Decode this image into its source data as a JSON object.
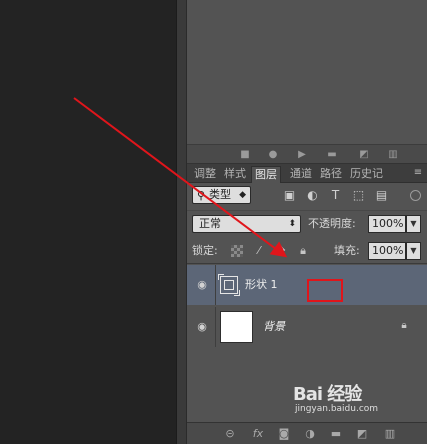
{
  "upper_toolbar": {
    "icons": [
      "stop-icon",
      "record-icon",
      "play-icon",
      "folder-icon",
      "new-action-icon",
      "trash-icon"
    ]
  },
  "tabs": [
    {
      "label": "调整",
      "active": false
    },
    {
      "label": "样式",
      "active": false
    },
    {
      "label": "图层",
      "active": true
    },
    {
      "label": "通道",
      "active": false
    },
    {
      "label": "路径",
      "active": false
    },
    {
      "label": "历史记",
      "active": false
    }
  ],
  "filter": {
    "kind_label": "类型",
    "icons": [
      "pixel-filter-icon",
      "adjustment-filter-icon",
      "type-filter-icon",
      "shape-filter-icon",
      "smart-object-filter-icon"
    ]
  },
  "blend": {
    "mode": "正常",
    "opacity_label": "不透明度:",
    "opacity_value": "100%"
  },
  "lock": {
    "label": "锁定:",
    "fill_label": "填充:",
    "fill_value": "100%"
  },
  "layers": [
    {
      "name": "形状 1",
      "kind": "shape",
      "selected": true,
      "visible": true
    },
    {
      "name": "背景",
      "kind": "background",
      "selected": false,
      "visible": true,
      "locked": true
    }
  ],
  "bottom_bar": {
    "icons": [
      "link-icon",
      "fx-icon",
      "mask-icon",
      "adjustment-icon",
      "group-icon",
      "new-layer-icon",
      "delete-icon"
    ],
    "fx_label": "fx"
  },
  "watermark": {
    "logo": "Bai 经验",
    "url": "jingyan.baidu.com"
  },
  "colors": {
    "accent_annotation": "#e0151b",
    "selected_row": "#5c6677",
    "panel_bg": "#535353",
    "canvas_bg": "#232323"
  }
}
